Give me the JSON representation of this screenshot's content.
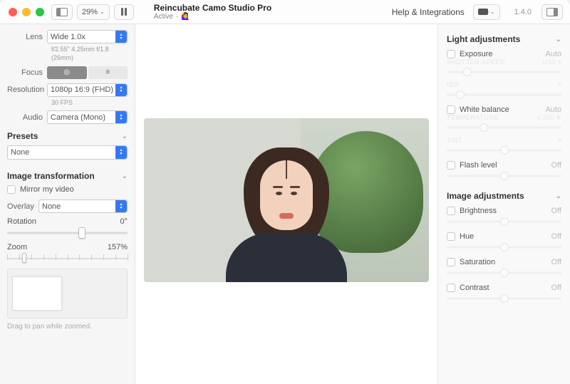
{
  "titlebar": {
    "zoom_pct": "29%",
    "app_title": "Reincubate Camo Studio Pro",
    "status": "Active",
    "help_label": "Help & Integrations",
    "version": "1.4.0"
  },
  "left": {
    "lens_label": "Lens",
    "lens_value": "Wide 1.0x",
    "lens_meta1": "f/2.55\" 4.25mm f/1.8",
    "lens_meta2": "(26mm)",
    "focus_label": "Focus",
    "resolution_label": "Resolution",
    "resolution_value": "1080p 16:9 (FHD)",
    "fps_meta": "30 FPS",
    "audio_label": "Audio",
    "audio_value": "Camera (Mono)",
    "presets_head": "Presets",
    "presets_value": "None",
    "transform_head": "Image transformation",
    "mirror_label": "Mirror my video",
    "overlay_label": "Overlay",
    "overlay_value": "None",
    "rotation_label": "Rotation",
    "rotation_value": "0°",
    "zoom_label": "Zoom",
    "zoom_value": "157%",
    "hint": "Drag to pan while zoomed."
  },
  "right": {
    "light_head": "Light adjustments",
    "exposure_label": "Exposure",
    "exposure_value": "Auto",
    "shutter_l": "SHUTTER SPEED",
    "shutter_r": "1/33 s",
    "iso_l": "ISO",
    "wb_label": "White balance",
    "wb_value": "Auto",
    "temp_l": "TEMPERATURE",
    "temp_r": "4,350 K",
    "tint_l": "TINT",
    "flash_label": "Flash level",
    "flash_value": "Off",
    "image_head": "Image adjustments",
    "brightness_label": "Brightness",
    "brightness_value": "Off",
    "hue_label": "Hue",
    "hue_value": "Off",
    "sat_label": "Saturation",
    "sat_value": "Off",
    "contrast_label": "Contrast",
    "contrast_value": "Off"
  }
}
